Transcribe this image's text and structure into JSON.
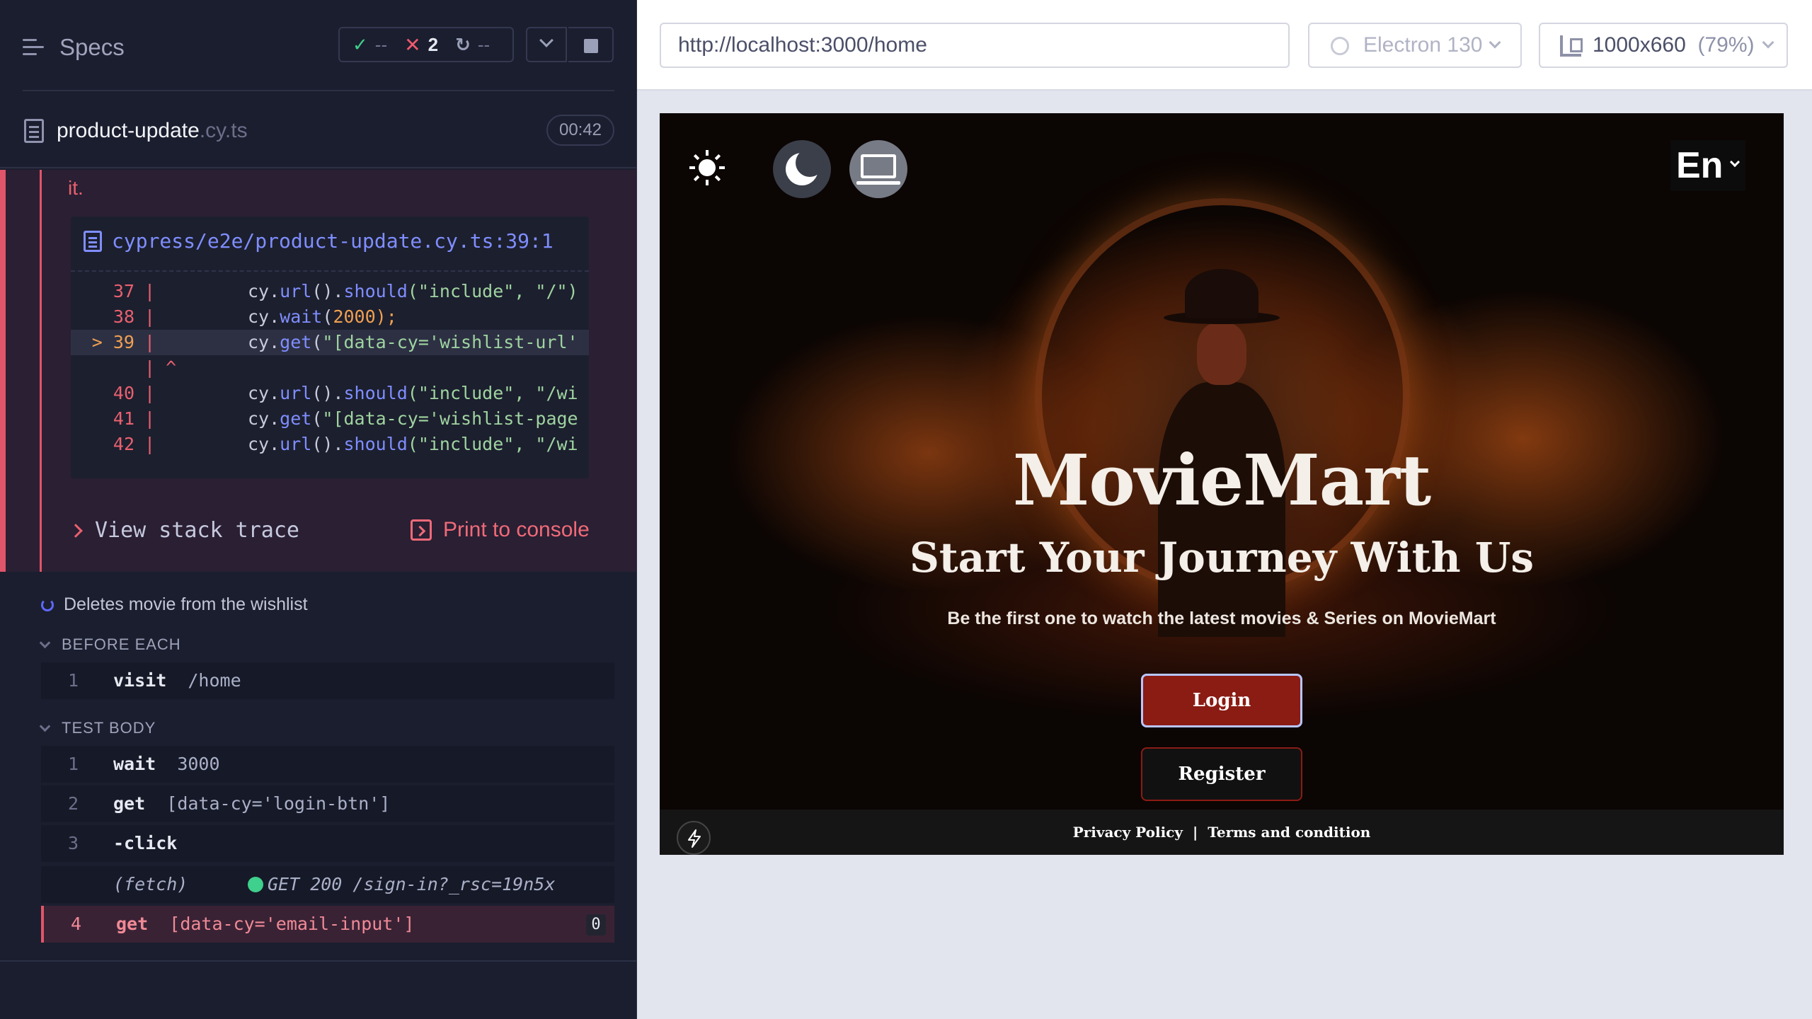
{
  "reporter": {
    "header": {
      "title": "Specs",
      "passed": "--",
      "failed": "2",
      "pending": "--"
    },
    "spec": {
      "name": "product-update",
      "ext": ".cy.ts",
      "duration": "00:42"
    },
    "error": {
      "trailing_text": "it.",
      "file_path": "cypress/e2e/product-update.cy.ts:39:1",
      "code_lines": [
        {
          "num": "37",
          "code_prefix": "cy.",
          "method": "url",
          "rest": "().",
          "method2": "should",
          "args": "(\"include\", \"/\")"
        },
        {
          "num": "38",
          "code_prefix": "cy.",
          "method": "wait",
          "rest": "(",
          "method2": "",
          "args": "2000);"
        },
        {
          "num": "> 39",
          "code_prefix": "cy.",
          "method": "get",
          "rest": "(",
          "method2": "",
          "args": "\"[data-cy='wishlist-url'"
        },
        {
          "num": "40",
          "code_prefix": "cy.",
          "method": "url",
          "rest": "().",
          "method2": "should",
          "args": "(\"include\", \"/wi"
        },
        {
          "num": "41",
          "code_prefix": "cy.",
          "method": "get",
          "rest": "(",
          "method2": "",
          "args": "\"[data-cy='wishlist-page"
        },
        {
          "num": "42",
          "code_prefix": "cy.",
          "method": "url",
          "rest": "().",
          "method2": "should",
          "args": "(\"include\", \"/wi"
        }
      ],
      "caret_line": "| ^",
      "view_stack_trace": "View stack trace",
      "print_to_console": "Print to console"
    },
    "test": {
      "title": "Deletes movie from the wishlist",
      "before_each_label": "BEFORE EACH",
      "test_body_label": "TEST BODY",
      "before_each": [
        {
          "num": "1",
          "name": "visit",
          "arg": "/home"
        }
      ],
      "body": [
        {
          "num": "1",
          "name": "wait",
          "arg": "3000"
        },
        {
          "num": "2",
          "name": "get",
          "arg": "[data-cy='login-btn']"
        },
        {
          "num": "3",
          "name": "-click",
          "arg": ""
        },
        {
          "num": "4",
          "name": "get",
          "arg": "[data-cy='email-input']",
          "badge": "0"
        }
      ],
      "fetch": {
        "label": "(fetch)",
        "request": "GET 200 /sign-in?_rsc=19n5x"
      }
    }
  },
  "browser": {
    "url": "http://localhost:3000/home",
    "browser_name": "Electron 130",
    "viewport_size": "1000x660",
    "viewport_pct": "(79%)"
  },
  "app": {
    "language": "En",
    "brand": "MovieMart",
    "tagline": "Start Your Journey With Us",
    "subtitle": "Be the first one to watch the latest movies & Series on MovieMart",
    "login_label": "Login",
    "register_label": "Register",
    "footer": {
      "privacy": "Privacy Policy",
      "separator": "|",
      "terms": "Terms and condition"
    }
  }
}
